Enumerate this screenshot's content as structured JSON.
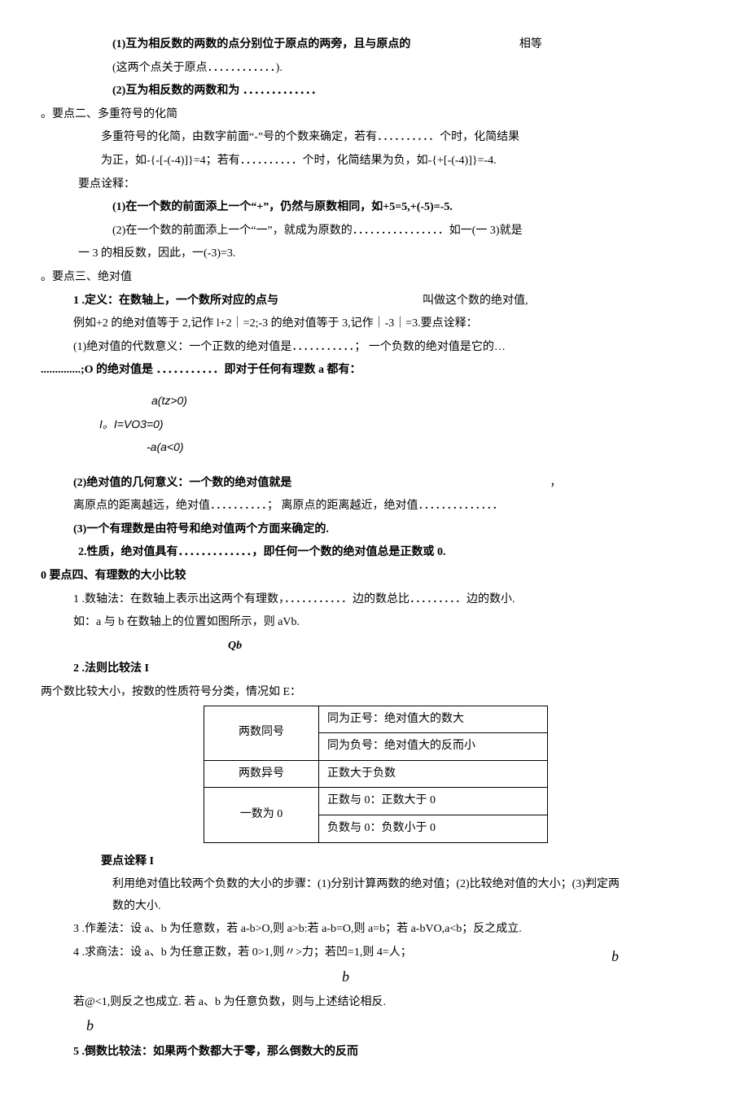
{
  "p1": "(1)互为相反数的两数的点分别位于原点的两旁，且与原点的",
  "p1r": "相等",
  "p2": "(这两个点关于原点．．．．．．．．．．．．).",
  "p3": "(2)互为相反数的两数和为 ．．．．．．．．．．．．．",
  "h2": "。要点二、多重符号的化简",
  "p4": "多重符号的化简，由数字前面“-”号的个数来确定，若有．．．．．．．．．．个时，化简结果",
  "p5": "为正，如-{-[-(-4)]}=4；若有．．．．．．．．．．个时，化简结果为负，如-{+[-(-4)]}=-4.",
  "p6": "要点诠释：",
  "p7": "(1)在一个数的前面添上一个“+”，仍然与原数相同，如+5=5,+(-5)=-5.",
  "p8": "(2)在一个数的前面添上一个“一”，就成为原数的．．．．．．．．．．．．．．．．如一(一 3)就是",
  "p9": "一 3 的相反数，因此，一(-3)=3.",
  "h3": "。要点三、绝对值",
  "p10a": "1 .定义：在数轴上，一个数所对应的点与",
  "p10b": "叫做这个数的绝对值,",
  "p11": "例如+2 的绝对值等于 2,记作 l+2｜=2;-3 的绝对值等于 3,记作｜-3｜=3.要点诠释：",
  "p12": "(1)绝对值的代数意义：一个正数的绝对值是．．．．．．．．．．．； 一个负数的绝对值是它的…",
  "p13": "..............;O 的绝对值是 ．．．．．．．．．．．即对于任何有理数 a 都有：",
  "f1": "a(tz>0)",
  "f2": "I。I=VO3=0)",
  "f3": "-a(a<0)",
  "p14a": "(2)绝对值的几何意义：一个数的绝对值就是",
  "p14b": "，",
  "p15": "离原点的距离越远，绝对值．．．．．．．．．．； 离原点的距离越近，绝对值．．．．．．．．．．．．．．",
  "p16": "(3)一个有理数是由符号和绝对值两个方面来确定的.",
  "p17": "2.性质，绝对值具有．．．．．．．．．．．．．，即任何一个数的绝对值总是正数或 0.",
  "h4": "0 要点四、有理数的大小比较",
  "p18": "1 .数轴法：在数轴上表示出这两个有理数，．．．．．．．．．．．边的数总比．．．．．．．．．边的数小.",
  "p19": "如：a 与 b 在数轴上的位置如图所示，则 aVb.",
  "qb": "Qb",
  "p20": "2 .法则比较法 I",
  "p21": "两个数比较大小，按数的性质符号分类，情况如 E：",
  "t": {
    "r1c1": "两数同号",
    "r1c2": "同为正号：绝对值大的数大",
    "r2c2": "同为负号：绝对值大的反而小",
    "r3c1": "两数异号",
    "r3c2": "正数大于负数",
    "r4c1": "一数为 0",
    "r4c2": "正数与 0：正数大于 0",
    "r5c2": "负数与 0：负数小于 0"
  },
  "p22": "要点诠释 I",
  "p23": "利用绝对值比较两个负数的大小的步骤：(1)分别计算两数的绝对值；(2)比较绝对值的大小；(3)判定两数的大小.",
  "p24": "3 .作差法：设 a、b 为任意数，若 a-b>O,则 a>b:若 a-b=O,则 a=b；若 a-bVO,a<b；反之成立.",
  "p25": "4 .求商法：设 a、b 为任意正数，若 0>1,则〃>力；若凹=1,则 4=人；",
  "p25b": "b",
  "farb": "b",
  "p26": "若@<1,则反之也成立. 若 a、b 为任意负数，则与上述结论相反.",
  "p26b": "b",
  "p27": "5 .倒数比较法：如果两个数都大于零，那么倒数大的反而"
}
